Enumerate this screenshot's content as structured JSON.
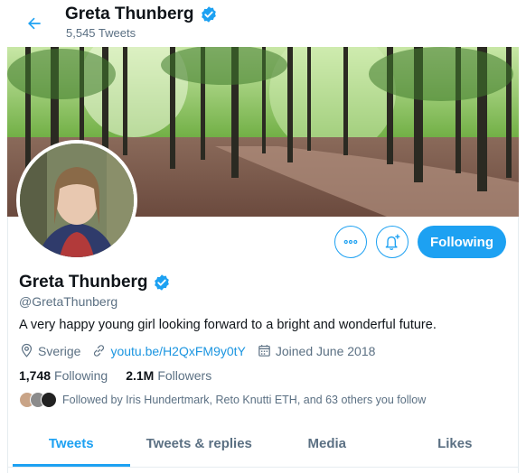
{
  "header": {
    "title": "Greta Thunberg",
    "tweet_count": "5,545 Tweets"
  },
  "profile": {
    "name": "Greta Thunberg",
    "handle": "@GretaThunberg",
    "bio": "A very happy young girl looking forward to a bright and wonderful future.",
    "location": "Sverige",
    "website": "youtu.be/H2QxFM9y0tY",
    "joined": "Joined June 2018",
    "following_count": "1,748",
    "following_label": "Following",
    "followers_count": "2.1M",
    "followers_label": "Followers",
    "followed_by": "Followed by Iris Hundertmark, Reto Knutti ETH, and 63 others you follow"
  },
  "actions": {
    "follow_label": "Following"
  },
  "tabs": [
    {
      "label": "Tweets"
    },
    {
      "label": "Tweets & replies"
    },
    {
      "label": "Media"
    },
    {
      "label": "Likes"
    }
  ],
  "colors": {
    "accent": "#1da1f2",
    "secondary_text": "#5b7083",
    "link": "#1b95e0"
  }
}
